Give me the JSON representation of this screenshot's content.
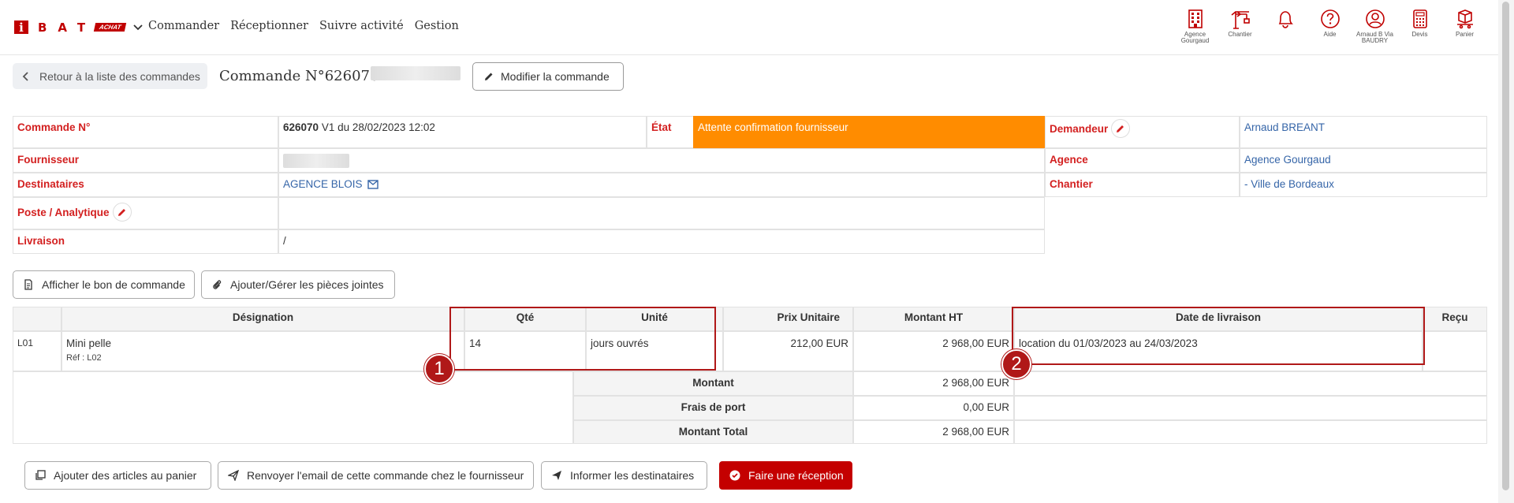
{
  "nav": {
    "logo_letter": "i",
    "logo_text": "BAT",
    "logo_badge": "ACHAT",
    "menu": [
      "Commander",
      "Réceptionner",
      "Suivre activité",
      "Gestion"
    ],
    "icons": [
      {
        "icon": "building-icon",
        "label": "Agence Gourgaud"
      },
      {
        "icon": "crane-icon",
        "label": "Chantier"
      },
      {
        "icon": "bell-icon",
        "label": ""
      },
      {
        "icon": "help-icon",
        "label": "Aide"
      },
      {
        "icon": "user-icon",
        "label": "Arnaud B Via BAUDRY"
      },
      {
        "icon": "calculator-icon",
        "label": "Devis"
      },
      {
        "icon": "cart-icon",
        "label": "Panier"
      }
    ]
  },
  "header": {
    "back_label": "Retour à la liste des commandes",
    "order_title": "Commande N°626070 -",
    "edit_label": "Modifier la commande"
  },
  "info": {
    "order_no_label": "Commande N°",
    "order_no_value": "626070",
    "order_no_suffix": " V1 du 28/02/2023 12:02",
    "state_label": "État",
    "state_value": "Attente confirmation fournisseur",
    "requester_label": "Demandeur",
    "requester_value": "Arnaud BREANT",
    "supplier_label": "Fournisseur",
    "agency_label": "Agence",
    "agency_value": "Agence Gourgaud",
    "recipients_label": "Destinataires",
    "recipients_value": "AGENCE BLOIS",
    "site_label": "Chantier",
    "site_value": "- Ville de Bordeaux",
    "post_label": "Poste / Analytique",
    "delivery_label": "Livraison",
    "delivery_value": "/"
  },
  "actions_top": {
    "show_po": "Afficher le bon de commande",
    "attachments": "Ajouter/Gérer les pièces jointes"
  },
  "table": {
    "headers": [
      "Désignation",
      "Qté",
      "Unité",
      "Prix Unitaire",
      "Montant HT",
      "Date de livraison",
      "Reçu"
    ],
    "row": {
      "line": "L01",
      "designation": "Mini pelle",
      "ref": "Réf : L02",
      "qty": "14",
      "unit": "jours ouvrés",
      "unit_price": "212,00 EUR",
      "amount": "2 968,00 EUR",
      "delivery": "location du 01/03/2023 au 24/03/2023"
    },
    "totals": [
      {
        "label": "Montant",
        "value": "2 968,00 EUR"
      },
      {
        "label": "Frais de port",
        "value": "0,00 EUR"
      },
      {
        "label": "Montant Total",
        "value": "2 968,00 EUR"
      }
    ]
  },
  "actions_bottom": {
    "add_cart": "Ajouter des articles au panier",
    "resend": "Renvoyer l'email de cette commande chez le fournisseur",
    "inform": "Informer les destinataires",
    "receive": "Faire une réception"
  },
  "annotations": [
    "1",
    "2"
  ],
  "colors": {
    "brand": "#c00000",
    "status": "#ff8c00",
    "link": "#3565a8",
    "label": "#d32020"
  }
}
